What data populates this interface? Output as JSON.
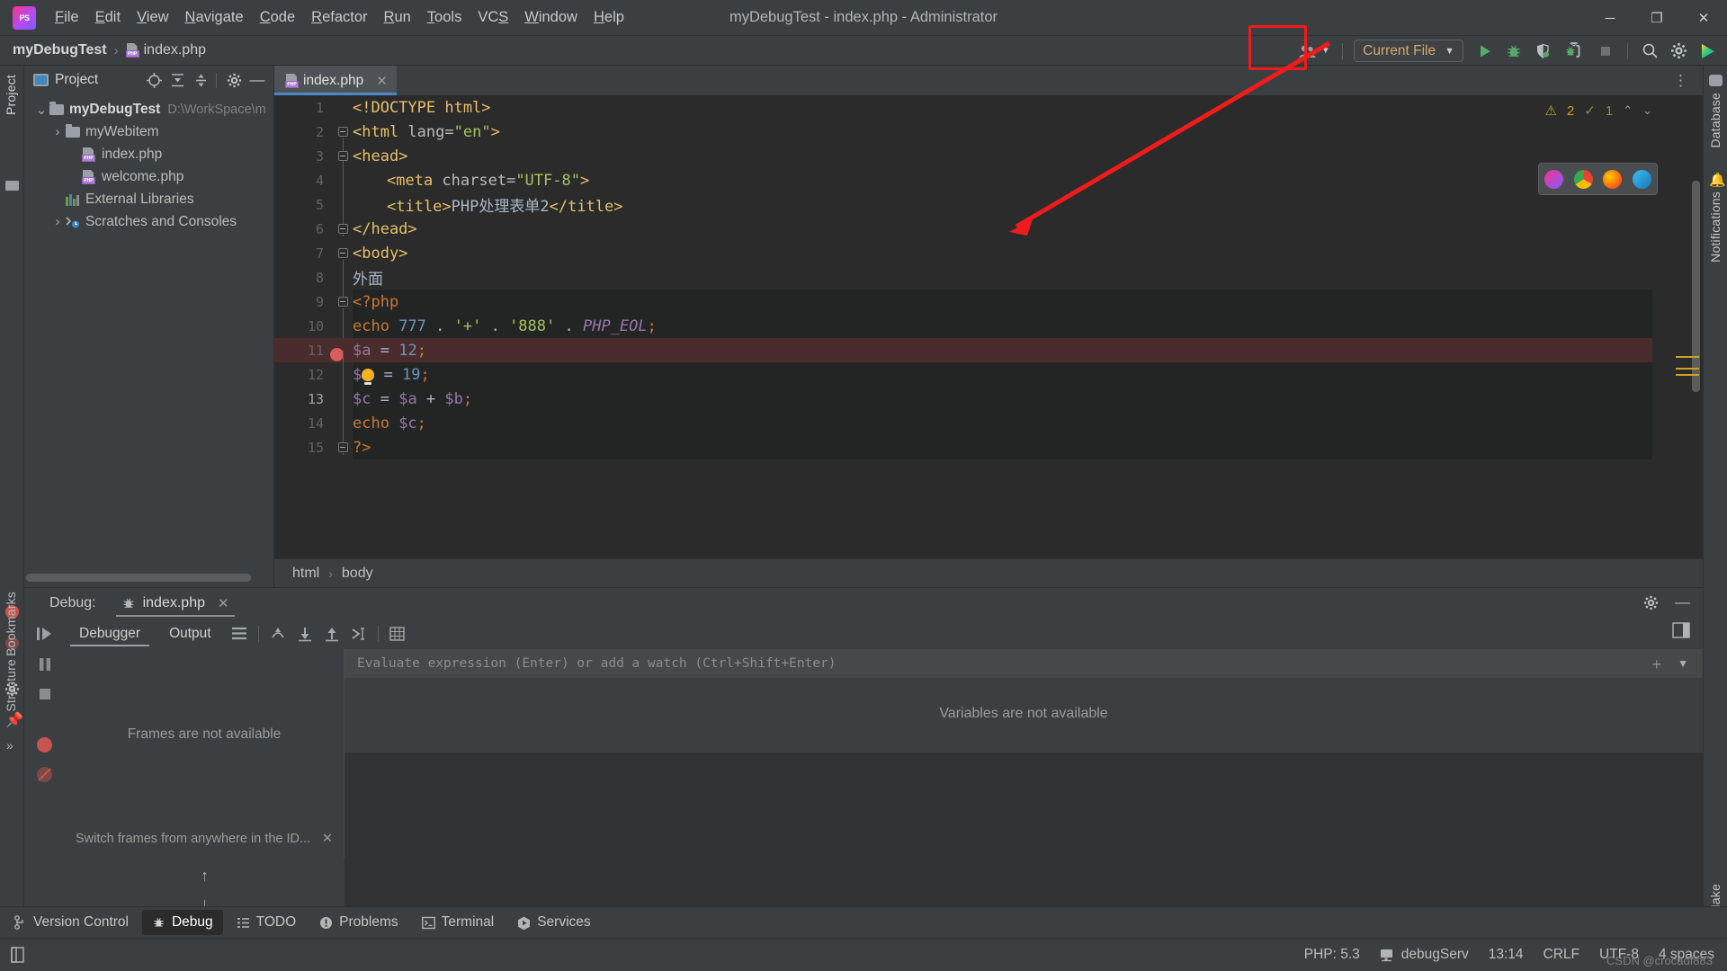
{
  "window": {
    "title": "myDebugTest - index.php - Administrator",
    "app_icon": "phpstorm-logo-icon",
    "minimize": "─",
    "maximize": "❐",
    "close": "✕"
  },
  "menu": [
    {
      "label": "File",
      "mnemonic": "F"
    },
    {
      "label": "Edit",
      "mnemonic": "E"
    },
    {
      "label": "View",
      "mnemonic": "V"
    },
    {
      "label": "Navigate",
      "mnemonic": "N"
    },
    {
      "label": "Code",
      "mnemonic": "C"
    },
    {
      "label": "Refactor",
      "mnemonic": "R"
    },
    {
      "label": "Run",
      "mnemonic": "R"
    },
    {
      "label": "Tools",
      "mnemonic": "T"
    },
    {
      "label": "VCS",
      "mnemonic": "S"
    },
    {
      "label": "Window",
      "mnemonic": "W"
    },
    {
      "label": "Help",
      "mnemonic": "H"
    }
  ],
  "navbar": {
    "project_crumb": "myDebugTest",
    "separator": "›",
    "file_crumb": "index.php",
    "run_config": "Current File",
    "run_config_caret": "▼",
    "avatar_caret": "▼"
  },
  "toolbar": {
    "buttons": [
      {
        "name": "run-button",
        "icon": "play-triangle-icon",
        "color": "#59a869"
      },
      {
        "name": "debug-button",
        "icon": "bug-icon",
        "color": "#59a869"
      },
      {
        "name": "run-with-coverage-button",
        "icon": "shield-coverage-icon",
        "color": "#9aa0a6"
      },
      {
        "name": "phone-debug-listener-button",
        "icon": "phone-bug-icon",
        "color": "#9aa0a6"
      },
      {
        "name": "stop-button",
        "icon": "stop-square-icon",
        "color": "#7a7d7f"
      },
      {
        "name": "search-everywhere-button",
        "icon": "search-icon",
        "color": "#c5c5c5"
      },
      {
        "name": "settings-button",
        "icon": "gear-icon",
        "color": "#c5c5c5"
      },
      {
        "name": "updates-button",
        "icon": "colored-play-icon",
        "color": "#3ea0d8"
      }
    ],
    "highlight_color": "#f01b1b",
    "highlight_target": "phone-debug-listener-button"
  },
  "project_panel": {
    "title": "Project",
    "header_icons": [
      "target-scope-icon",
      "collapse-all-icon",
      "expand-selection-icon",
      "gear-icon",
      "hide-icon"
    ],
    "tree": [
      {
        "label": "myDebugTest",
        "path": "D:\\WorkSpace\\m",
        "icon": "folder-icon",
        "expanded": true,
        "depth": 0,
        "bold": true
      },
      {
        "label": "myWebitem",
        "path": "",
        "icon": "folder-icon",
        "expanded": false,
        "depth": 1,
        "bold": false
      },
      {
        "label": "index.php",
        "path": "",
        "icon": "php-file-icon",
        "depth": 2,
        "bold": false
      },
      {
        "label": "welcome.php",
        "path": "",
        "icon": "php-file-icon",
        "depth": 2,
        "bold": false
      },
      {
        "label": "External Libraries",
        "path": "",
        "icon": "libraries-icon",
        "depth": 1,
        "bold": false
      },
      {
        "label": "Scratches and Consoles",
        "path": "",
        "icon": "scratches-icon",
        "expanded": false,
        "depth": 1,
        "bold": false
      }
    ]
  },
  "sidebars": {
    "left_top_label": "Project",
    "left_bottom_labels": [
      "Bookmarks",
      "Structure"
    ],
    "right_labels": [
      "Database",
      "Notifications"
    ],
    "right_bottom_label": "Make"
  },
  "editor": {
    "tab": {
      "label": "index.php",
      "icon": "php-file-icon",
      "close": "✕"
    },
    "options_icon": "more-vertical-icon",
    "inspection": {
      "warning_count": "2",
      "warning_icon": "warning-triangle-icon",
      "ok_count": "1",
      "ok_icon": "check-icon",
      "up": "⌃",
      "down": "⌄"
    },
    "browser_popup_icons": [
      "browser-phpstorm-icon",
      "browser-chrome-icon",
      "browser-firefox-icon",
      "browser-edge-icon"
    ],
    "breadcrumb": [
      "html",
      "body"
    ],
    "breadcrumb_sep": "›",
    "lines": [
      {
        "num": "1",
        "fold": "none",
        "indent": 0,
        "breakpoint": false,
        "php_bg": false,
        "tokens": [
          {
            "t": "tag",
            "v": "<!DOCTYPE html>"
          }
        ]
      },
      {
        "num": "2",
        "fold": "open",
        "indent": 0,
        "breakpoint": false,
        "php_bg": false,
        "tokens": [
          {
            "t": "tag",
            "v": "<html "
          },
          {
            "t": "attr",
            "v": "lang="
          },
          {
            "t": "str",
            "v": "\"en\""
          },
          {
            "t": "tag",
            "v": ">"
          }
        ]
      },
      {
        "num": "3",
        "fold": "open",
        "indent": 0,
        "breakpoint": false,
        "php_bg": false,
        "tokens": [
          {
            "t": "tag",
            "v": "<head>"
          }
        ]
      },
      {
        "num": "4",
        "fold": "line",
        "indent": 1,
        "breakpoint": false,
        "php_bg": false,
        "tokens": [
          {
            "t": "tag",
            "v": "<meta "
          },
          {
            "t": "attr",
            "v": "charset="
          },
          {
            "t": "str",
            "v": "\"UTF-8\""
          },
          {
            "t": "tag",
            "v": ">"
          }
        ]
      },
      {
        "num": "5",
        "fold": "line",
        "indent": 1,
        "breakpoint": false,
        "php_bg": false,
        "tokens": [
          {
            "t": "tag",
            "v": "<title>"
          },
          {
            "t": "txt",
            "v": "PHP处理表单2"
          },
          {
            "t": "tag",
            "v": "</title>"
          }
        ]
      },
      {
        "num": "6",
        "fold": "close",
        "indent": 0,
        "breakpoint": false,
        "php_bg": false,
        "tokens": [
          {
            "t": "tag",
            "v": "</head>"
          }
        ]
      },
      {
        "num": "7",
        "fold": "open",
        "indent": 0,
        "breakpoint": false,
        "php_bg": false,
        "tokens": [
          {
            "t": "tag",
            "v": "<body>"
          }
        ]
      },
      {
        "num": "8",
        "fold": "line",
        "indent": 0,
        "breakpoint": false,
        "php_bg": false,
        "tokens": [
          {
            "t": "txt",
            "v": "外面"
          }
        ]
      },
      {
        "num": "9",
        "fold": "open",
        "indent": 0,
        "breakpoint": false,
        "php_bg": true,
        "tokens": [
          {
            "t": "kw",
            "v": "<?php"
          }
        ]
      },
      {
        "num": "10",
        "fold": "line",
        "indent": 0,
        "breakpoint": false,
        "php_bg": true,
        "tokens": [
          {
            "t": "kw",
            "v": "echo "
          },
          {
            "t": "num",
            "v": "777"
          },
          {
            "t": "punc",
            "v": " . "
          },
          {
            "t": "str",
            "v": "'+'"
          },
          {
            "t": "punc",
            "v": " . "
          },
          {
            "t": "str",
            "v": "'888'"
          },
          {
            "t": "punc",
            "v": " . "
          },
          {
            "t": "const",
            "v": "PHP_EOL"
          },
          {
            "t": "semi",
            "v": ";"
          }
        ]
      },
      {
        "num": "11",
        "fold": "line",
        "indent": 0,
        "breakpoint": true,
        "php_bg": true,
        "tokens": [
          {
            "t": "var",
            "v": "$a"
          },
          {
            "t": "punc",
            "v": " = "
          },
          {
            "t": "num",
            "v": "12"
          },
          {
            "t": "semi",
            "v": ";"
          }
        ]
      },
      {
        "num": "12",
        "fold": "line",
        "indent": 0,
        "breakpoint": false,
        "php_bg": true,
        "bulb": true,
        "tokens": [
          {
            "t": "var",
            "v": "$"
          },
          {
            "t": "bulb",
            "v": "b"
          },
          {
            "t": "punc",
            "v": " = "
          },
          {
            "t": "num",
            "v": "19"
          },
          {
            "t": "semi",
            "v": ";"
          }
        ]
      },
      {
        "num": "13",
        "fold": "line",
        "indent": 0,
        "breakpoint": false,
        "php_bg": true,
        "current": true,
        "tokens": [
          {
            "t": "var",
            "v": "$c"
          },
          {
            "t": "punc",
            "v": " = "
          },
          {
            "t": "var",
            "v": "$a"
          },
          {
            "t": "punc",
            "v": " + "
          },
          {
            "t": "var",
            "v": "$b"
          },
          {
            "t": "semi",
            "v": ";"
          }
        ]
      },
      {
        "num": "14",
        "fold": "line",
        "indent": 0,
        "breakpoint": false,
        "php_bg": true,
        "tokens": [
          {
            "t": "kw",
            "v": "echo "
          },
          {
            "t": "var",
            "v": "$c"
          },
          {
            "t": "semi",
            "v": ";"
          }
        ]
      },
      {
        "num": "15",
        "fold": "close",
        "indent": 0,
        "breakpoint": false,
        "php_bg": true,
        "tokens": [
          {
            "t": "kw",
            "v": "?>"
          }
        ]
      }
    ]
  },
  "debug": {
    "label": "Debug:",
    "session_tab": "index.php",
    "session_icon": "bug-icon",
    "session_close": "✕",
    "header_icons": [
      "gear-icon",
      "hide-icon"
    ],
    "tabs": [
      {
        "label": "Debugger",
        "active": true
      },
      {
        "label": "Output",
        "active": false
      }
    ],
    "tab_icons": [
      "layout-icon",
      "step-out-icon",
      "step-into-icon",
      "step-over-icon",
      "run-to-cursor-icon",
      "table-icon"
    ],
    "side_icons": [
      "resume-program-icon",
      "pause-program-icon",
      "stop-icon",
      "view-breakpoints-icon",
      "mute-breakpoints-icon"
    ],
    "bottom_icons": [
      "arrow-up-icon",
      "arrow-down-icon",
      "pin-icon",
      "more-icon"
    ],
    "frames_message": "Frames are not available",
    "frames_hint": "Switch frames from anywhere in the ID...",
    "frames_hint_close": "✕",
    "eval_placeholder": "Evaluate expression (Enter) or add a watch (Ctrl+Shift+Enter)",
    "eval_plus": "+",
    "eval_caret": "▼",
    "variables_message": "Variables are not available",
    "layout_icon": "restore-layout-icon"
  },
  "tool_window_bar": [
    {
      "label": "Version Control",
      "icon": "branch-icon",
      "active": false
    },
    {
      "label": "Debug",
      "icon": "bug-icon",
      "active": true
    },
    {
      "label": "TODO",
      "icon": "list-icon",
      "active": false
    },
    {
      "label": "Problems",
      "icon": "exclamation-circle-icon",
      "active": false
    },
    {
      "label": "Terminal",
      "icon": "terminal-icon",
      "active": false
    },
    {
      "label": "Services",
      "icon": "services-play-icon",
      "active": false
    }
  ],
  "status_bar": {
    "left_icon": "toggle-tool-window-icon",
    "items": [
      {
        "label": "PHP: 5.3",
        "name": "php-version"
      },
      {
        "label": "debugServ",
        "name": "deployment-server",
        "icon": "server-icon"
      },
      {
        "label": "13:14",
        "name": "caret-position"
      },
      {
        "label": "CRLF",
        "name": "line-separator"
      },
      {
        "label": "UTF-8",
        "name": "file-encoding"
      },
      {
        "label": "4 spaces",
        "name": "indent-setting"
      }
    ],
    "watermark": "CSDN @crocadf883"
  }
}
